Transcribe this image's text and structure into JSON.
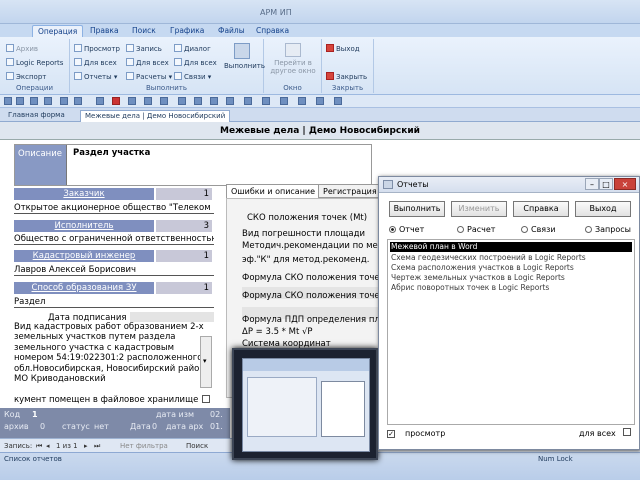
{
  "app": {
    "title": "АРМ ИП"
  },
  "ribbon_tabs": [
    "Операция",
    "Правка",
    "Поиск",
    "Графика",
    "Файлы",
    "Справка"
  ],
  "ribbon": {
    "operations": {
      "items": [
        "Архив",
        "Logic Reports",
        "Экспорт"
      ],
      "label": "Операции"
    },
    "execute": {
      "col1": [
        "Просмотр",
        "Для всех",
        "Отчеты"
      ],
      "col2": [
        "Запись",
        "Для всех",
        "Расчеты"
      ],
      "col3": [
        "Диалог",
        "Для всех",
        "Связи"
      ],
      "big": "Выполнить",
      "label": "Выполнить"
    },
    "window": {
      "big_line1": "Перейти в",
      "big_line2": "другое окно",
      "label": "Окно"
    },
    "exit": {
      "exit": "Выход",
      "close": "Закрыть",
      "label": "Закрыть"
    }
  },
  "doc_tabs": [
    "Главная форма",
    "Межевые дела | Демо Новосибирский"
  ],
  "form": {
    "title": "Межевые дела | Демо Новосибирский",
    "section_label": "Описание",
    "section_value": "Раздел участка",
    "customer_label": "Заказчик",
    "customer_num": "1",
    "customer_value": "Открытое акционерное общество \"Телеком",
    "executor_label": "Исполнитель",
    "executor_num": "3",
    "executor_value": "Общество с ограниченной ответственностью",
    "engineer_label": "Кадастровый инженер",
    "engineer_num": "1",
    "engineer_value": "Лавров Алексей Борисович",
    "method_label": "Способ образования ЗУ",
    "method_num": "1",
    "method_value": "Раздел",
    "sign_date_label": "Дата подписания",
    "note": "Вид кадастровых работ образованием 2-х земельных участков путем раздела земельного участка с кадастровым номером 54:19:022301:2 расположенного обл.Новосибирская, Новосибирский район, МО Криводановский",
    "file_note": "кумент помещен в файловое хранилище"
  },
  "right_tabs": [
    "Ошибки и описание",
    "Регистрация"
  ],
  "right_panel": [
    "СКО положения точек (Mt)",
    "Вид погрешности площади",
    "Методич.рекомендации по меж",
    "эф.\"К\" для метод.рекоменд.",
    "Формула СКО положения точек",
    "Формула СКО положения точек",
    "Формула ПДП определения пло",
    "ΔP = 3.5 * Mt √P",
    "Система координат"
  ],
  "bottom_bar": {
    "code_label": "Код",
    "code_val": "1",
    "arch_label": "архив",
    "arch_val": "0",
    "status_label": "статус",
    "status_val": "нет",
    "date_label": "Дата",
    "date_val": "0",
    "date_ism": "дата изм",
    "date_ism_val": "02.",
    "date_arch": "дата арх",
    "date_arch_val": "01."
  },
  "records": {
    "label": "Запись:",
    "position": "1 из 1",
    "filter": "Нет фильтра",
    "search": "Поиск"
  },
  "status": {
    "left": "Список отчетов",
    "right": "Num Lock"
  },
  "dialog": {
    "title": "Отчеты",
    "buttons": [
      "Выполнить",
      "Изменить",
      "Справка",
      "Выход"
    ],
    "radios": [
      "Отчет",
      "Расчет",
      "Связи",
      "Запросы"
    ],
    "list": [
      "Межевой план в Word",
      "Схема геодезических построений в Logic Reports",
      "Схема расположения участков в Logic Reports",
      "Чертеж земельных участков в Logic Reports",
      "Абрис поворотных точек в Logic Reports"
    ],
    "preview_label": "просмотр",
    "for_all_label": "для всех"
  }
}
